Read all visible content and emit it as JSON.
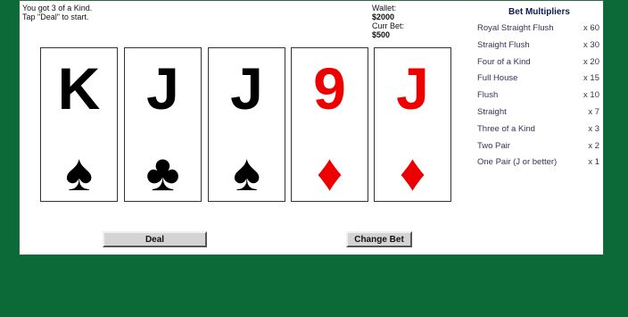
{
  "status": {
    "line1": "You got 3 of a Kind.",
    "line2": "Tap \"Deal\" to start."
  },
  "wallet": {
    "wallet_label": "Wallet:",
    "wallet_value": "$2000",
    "bet_label": "Curr Bet:",
    "bet_value": "$500"
  },
  "cards": [
    {
      "rank": "K",
      "suit": "♠",
      "suit_name": "spades",
      "color": "#000000"
    },
    {
      "rank": "J",
      "suit": "♣",
      "suit_name": "clubs",
      "color": "#000000"
    },
    {
      "rank": "J",
      "suit": "♠",
      "suit_name": "spades",
      "color": "#000000"
    },
    {
      "rank": "9",
      "suit": "♦",
      "suit_name": "diamonds",
      "color": "#ee0000"
    },
    {
      "rank": "J",
      "suit": "♦",
      "suit_name": "diamonds",
      "color": "#ee0000"
    }
  ],
  "buttons": {
    "deal": "Deal",
    "change_bet": "Change Bet"
  },
  "multipliers": {
    "title": "Bet Multipliers",
    "rows": [
      {
        "hand": "Royal Straight Flush",
        "value": "x 60"
      },
      {
        "hand": "Straight Flush",
        "value": "x 30"
      },
      {
        "hand": "Four of a Kind",
        "value": "x 20"
      },
      {
        "hand": "Full House",
        "value": "x 15"
      },
      {
        "hand": "Flush",
        "value": "x 10"
      },
      {
        "hand": "Straight",
        "value": "x 7"
      },
      {
        "hand": "Three of a Kind",
        "value": "x 3"
      },
      {
        "hand": "Two Pair",
        "value": "x 2"
      },
      {
        "hand": "One Pair (J or better)",
        "value": "x 1"
      }
    ]
  },
  "colors": {
    "table_green": "#0b6a38",
    "panel": "#ffffff",
    "red_suit": "#ee0000"
  }
}
